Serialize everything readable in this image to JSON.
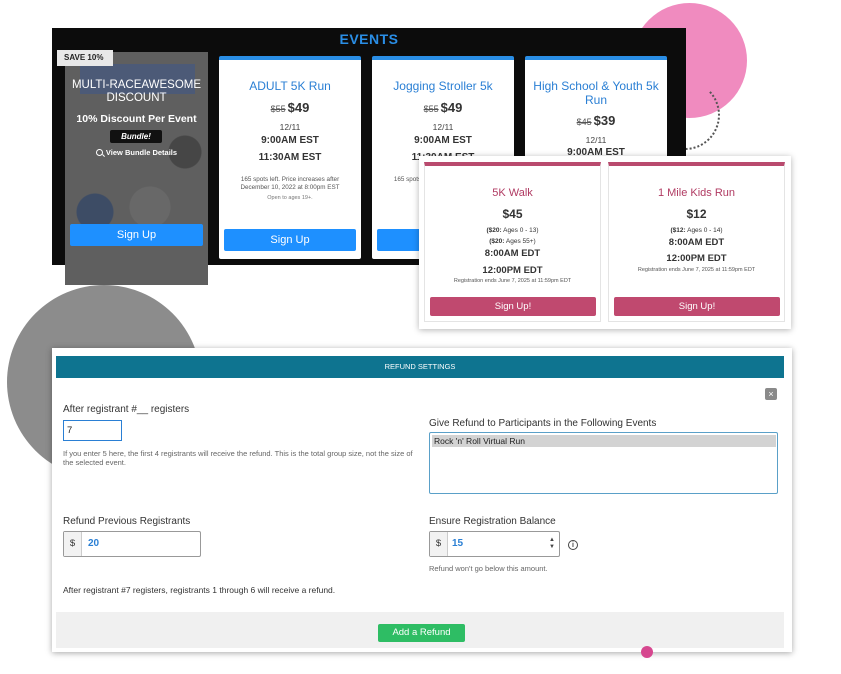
{
  "events": {
    "title": "EVENTS",
    "bundle": {
      "badge": "SAVE 10%",
      "title": "MULTI-RACEAWESOME DISCOUNT",
      "discount": "10% Discount Per Event",
      "tag": "Bundle!",
      "link": "View Bundle Details",
      "signup": "Sign Up"
    },
    "cards": [
      {
        "name": "ADULT 5K Run",
        "old_price": "$55",
        "price": "$49",
        "date": "12/11",
        "start": "9:00AM EST",
        "end": "11:30AM EST",
        "spots": "165 spots left. Price increases after December 10, 2022 at 8:00pm EST",
        "ages": "Open to ages 19+.",
        "signup": "Sign Up"
      },
      {
        "name": "Jogging Stroller 5k",
        "old_price": "$55",
        "price": "$49",
        "date": "12/11",
        "start": "9:00AM EST",
        "end": "11:30AM EST",
        "spots": "165 spots left. Price increases after December",
        "signup": "Sign Up"
      },
      {
        "name": "High School & Youth 5k Run",
        "old_price": "$45",
        "price": "$39",
        "date": "12/11",
        "start": "9:00AM EST"
      }
    ]
  },
  "featured": [
    {
      "name": "5K Walk",
      "price": "$45",
      "line1_price": "($20:",
      "line1_rest": "Ages 0 - 13)",
      "line2_price": "($20:",
      "line2_rest": "Ages 55+)",
      "start": "8:00AM EDT",
      "end": "12:00PM EDT",
      "reg": "Registration ends June 7, 2025 at 11:59pm EDT",
      "signup": "Sign Up!"
    },
    {
      "name": "1 Mile Kids Run",
      "price": "$12",
      "line1_price": "($12:",
      "line1_rest": "Ages 0 - 14)",
      "start": "8:00AM EDT",
      "end": "12:00PM EDT",
      "reg": "Registration ends June 7, 2025 at 11:59pm EDT",
      "signup": "Sign Up!"
    }
  ],
  "refund": {
    "header": "REFUND SETTINGS",
    "close": "×",
    "after_label": "After registrant #__ registers",
    "after_value": "7",
    "after_help": "If you enter 5 here, the first 4 registrants will receive the refund. This is the total group size, not the size of the selected event.",
    "events_label": "Give Refund to Participants in the Following Events",
    "events_item": "Rock 'n' Roll Virtual Run",
    "previous_label": "Refund Previous Registrants",
    "currency": "$",
    "previous_value": "20",
    "balance_label": "Ensure Registration Balance",
    "balance_value": "15",
    "balance_help": "Refund won't go below this amount.",
    "info_icon": "i",
    "summary": "After registrant #7 registers, registrants 1 through 6 will receive a refund.",
    "add_button": "Add a Refund"
  }
}
